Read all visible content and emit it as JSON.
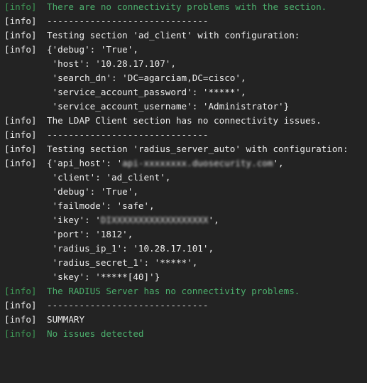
{
  "terminal": {
    "background_color": "#232323",
    "info_tag": "[info]",
    "colors": {
      "green": "#4caf6d",
      "tag_green": "#3f9a57",
      "white": "#ededed",
      "separator": "#d8d8d8",
      "background": "#232323"
    },
    "separator": "------------------------------",
    "lines": [
      {
        "tag": "[info]",
        "tag_color": "green",
        "text": "There are no connectivity problems with the section.",
        "color": "green",
        "indent": 0,
        "redacted": false
      },
      {
        "tag": "[info]",
        "tag_color": "white",
        "text": "------------------------------",
        "color": "separator",
        "indent": 0,
        "redacted": false
      },
      {
        "tag": "[info]",
        "tag_color": "white",
        "text": "Testing section 'ad_client' with configuration:",
        "color": "white",
        "indent": 0,
        "redacted": false
      },
      {
        "tag": "[info]",
        "tag_color": "white",
        "text": "{'debug': 'True',",
        "color": "white",
        "indent": 0,
        "redacted": false
      },
      {
        "tag": "",
        "tag_color": "white",
        "text": "'host': '10.28.17.107',",
        "color": "white",
        "indent": 1,
        "redacted": false
      },
      {
        "tag": "",
        "tag_color": "white",
        "text": "'search_dn': 'DC=agarciam,DC=cisco',",
        "color": "white",
        "indent": 1,
        "redacted": false
      },
      {
        "tag": "",
        "tag_color": "white",
        "text": "'service_account_password': '*****',",
        "color": "white",
        "indent": 1,
        "redacted": false
      },
      {
        "tag": "",
        "tag_color": "white",
        "text": "'service_account_username': 'Administrator'}",
        "color": "white",
        "indent": 1,
        "redacted": false
      },
      {
        "tag": "[info]",
        "tag_color": "white",
        "text": "The LDAP Client section has no connectivity issues.",
        "color": "white",
        "indent": 0,
        "redacted": false
      },
      {
        "tag": "[info]",
        "tag_color": "white",
        "text": "------------------------------",
        "color": "separator",
        "indent": 0,
        "redacted": false
      },
      {
        "tag": "[info]",
        "tag_color": "white",
        "text": "Testing section 'radius_server_auto' with configuration:",
        "color": "white",
        "indent": 0,
        "redacted": false
      },
      {
        "tag": "[info]",
        "tag_color": "white",
        "text": "{'api_host': '",
        "color": "white",
        "indent": 0,
        "redacted": true,
        "redacted_text": "api-xxxxxxxx.duosecurity.com",
        "text_after": "',"
      },
      {
        "tag": "",
        "tag_color": "white",
        "text": "'client': 'ad_client',",
        "color": "white",
        "indent": 1,
        "redacted": false
      },
      {
        "tag": "",
        "tag_color": "white",
        "text": "'debug': 'True',",
        "color": "white",
        "indent": 1,
        "redacted": false
      },
      {
        "tag": "",
        "tag_color": "white",
        "text": "'failmode': 'safe',",
        "color": "white",
        "indent": 1,
        "redacted": false
      },
      {
        "tag": "",
        "tag_color": "white",
        "text": "'ikey': '",
        "color": "white",
        "indent": 1,
        "redacted": true,
        "redacted_text": "DIXXXXXXXXXXXXXXXXXX",
        "text_after": "',"
      },
      {
        "tag": "",
        "tag_color": "white",
        "text": "'port': '1812',",
        "color": "white",
        "indent": 1,
        "redacted": false
      },
      {
        "tag": "",
        "tag_color": "white",
        "text": "'radius_ip_1': '10.28.17.101',",
        "color": "white",
        "indent": 1,
        "redacted": false
      },
      {
        "tag": "",
        "tag_color": "white",
        "text": "'radius_secret_1': '*****',",
        "color": "white",
        "indent": 1,
        "redacted": false
      },
      {
        "tag": "",
        "tag_color": "white",
        "text": "'skey': '*****[40]'}",
        "color": "white",
        "indent": 1,
        "redacted": false
      },
      {
        "tag": "[info]",
        "tag_color": "green",
        "text": "The RADIUS Server has no connectivity problems.",
        "color": "green",
        "indent": 0,
        "redacted": false
      },
      {
        "tag": "[info]",
        "tag_color": "white",
        "text": "------------------------------",
        "color": "separator",
        "indent": 0,
        "redacted": false
      },
      {
        "tag": "[info]",
        "tag_color": "white",
        "text": "SUMMARY",
        "color": "white",
        "indent": 0,
        "redacted": false
      },
      {
        "tag": "[info]",
        "tag_color": "green",
        "text": "No issues detected",
        "color": "green",
        "indent": 0,
        "redacted": false
      }
    ]
  }
}
